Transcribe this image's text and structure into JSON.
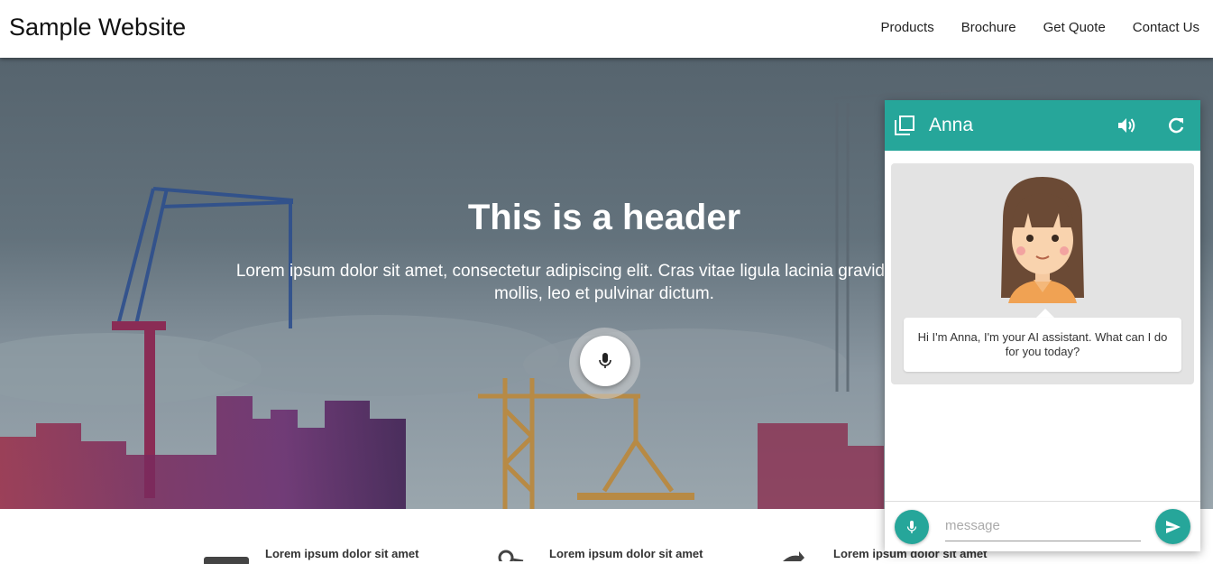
{
  "site": {
    "brand": "Sample Website",
    "nav": [
      {
        "label": "Products"
      },
      {
        "label": "Brochure"
      },
      {
        "label": "Get Quote"
      },
      {
        "label": "Contact Us"
      }
    ]
  },
  "hero": {
    "title": "This is a header",
    "text": "Lorem ipsum dolor sit amet, consectetur adipiscing elit. Cras vitae ligula lacinia gravida. Praesent mollis, leo et pulvinar dictum."
  },
  "features": [
    {
      "label": "Lorem ipsum dolor sit amet"
    },
    {
      "label": "Lorem ipsum dolor sit amet"
    },
    {
      "label": "Lorem ipsum dolor sit amet"
    }
  ],
  "chat": {
    "title": "Anna",
    "greeting": "Hi I'm Anna, I'm your AI assistant. What can I do for you today?",
    "input_placeholder": "message",
    "accent": "#26a69a",
    "icons": {
      "expand": "window-expand-icon",
      "sound": "volume-icon",
      "refresh": "refresh-icon",
      "mic": "microphone-icon",
      "send": "send-icon"
    }
  },
  "colors": {
    "hero_overlay": "#5a6873",
    "text_dark": "#222222",
    "white": "#ffffff"
  }
}
